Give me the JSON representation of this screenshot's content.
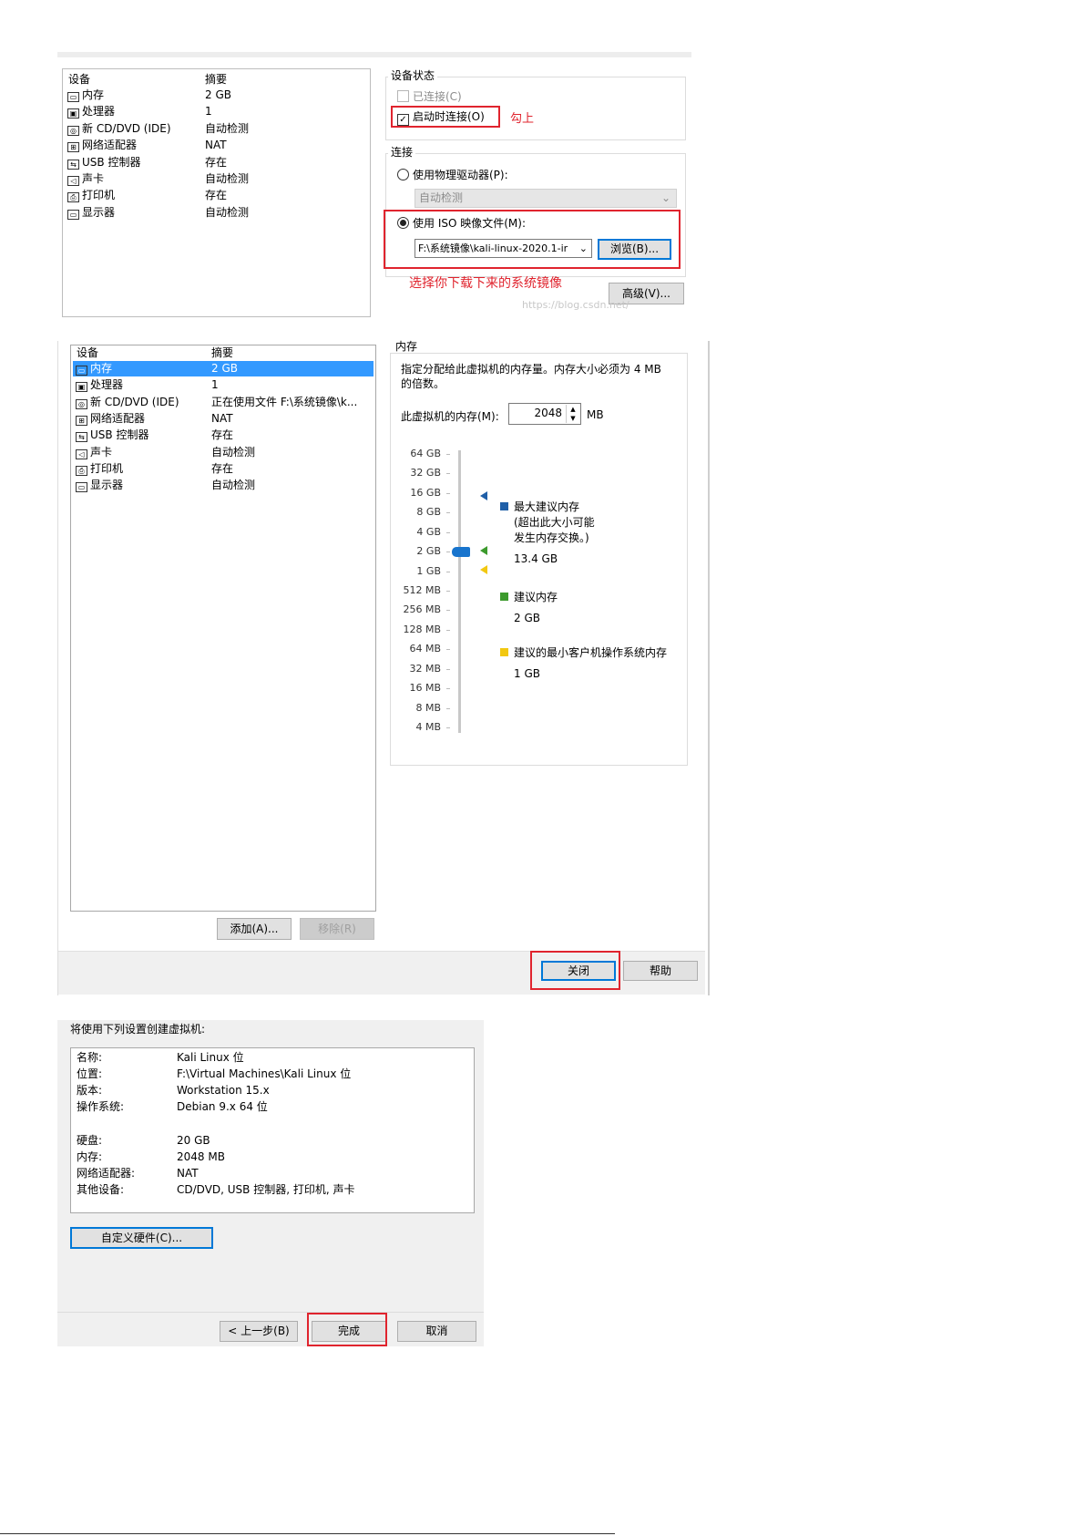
{
  "shot1": {
    "table_header": {
      "device": "设备",
      "summary": "摘要"
    },
    "devices": [
      {
        "icon": "memory-icon",
        "name": "内存",
        "summary": "2 GB"
      },
      {
        "icon": "processor-icon",
        "name": "处理器",
        "summary": "1"
      },
      {
        "icon": "cd-icon",
        "name": "新 CD/DVD (IDE)",
        "summary": "自动检测"
      },
      {
        "icon": "network-icon",
        "name": "网络适配器",
        "summary": "NAT"
      },
      {
        "icon": "usb-icon",
        "name": "USB 控制器",
        "summary": "存在"
      },
      {
        "icon": "sound-icon",
        "name": "声卡",
        "summary": "自动检测"
      },
      {
        "icon": "printer-icon",
        "name": "打印机",
        "summary": "存在"
      },
      {
        "icon": "display-icon",
        "name": "显示器",
        "summary": "自动检测"
      }
    ],
    "device_status": {
      "title": "设备状态",
      "connected": "已连接(C)",
      "connect_on_start": "启动时连接(O)",
      "annotation": "勾上"
    },
    "connection": {
      "title": "连接",
      "physical": "使用物理驱动器(P):",
      "physical_value": "自动检测",
      "iso": "使用 ISO 映像文件(M):",
      "iso_path": "F:\\系统镜像\\kali-linux-2020.1-ir",
      "browse": "浏览(B)...",
      "annotation": "选择你下载下来的系统镜像"
    },
    "advanced": "高级(V)...",
    "watermark": "https://blog.csdn.net/"
  },
  "shot2": {
    "table_header": {
      "device": "设备",
      "summary": "摘要"
    },
    "devices": [
      {
        "icon": "memory-icon",
        "name": "内存",
        "summary": "2 GB",
        "selected": true
      },
      {
        "icon": "processor-icon",
        "name": "处理器",
        "summary": "1"
      },
      {
        "icon": "cd-icon",
        "name": "新 CD/DVD (IDE)",
        "summary": "正在使用文件 F:\\系统镜像\\k..."
      },
      {
        "icon": "network-icon",
        "name": "网络适配器",
        "summary": "NAT"
      },
      {
        "icon": "usb-icon",
        "name": "USB 控制器",
        "summary": "存在"
      },
      {
        "icon": "sound-icon",
        "name": "声卡",
        "summary": "自动检测"
      },
      {
        "icon": "printer-icon",
        "name": "打印机",
        "summary": "存在"
      },
      {
        "icon": "display-icon",
        "name": "显示器",
        "summary": "自动检测"
      }
    ],
    "memory": {
      "title": "内存",
      "desc_line1": "指定分配给此虚拟机的内存量。内存大小必须为 4 MB",
      "desc_line2": "的倍数。",
      "label": "此虚拟机的内存(M):",
      "value": "2048",
      "unit": "MB",
      "scale": [
        "64 GB",
        "32 GB",
        "16 GB",
        "8 GB",
        "4 GB",
        "2 GB",
        "1 GB",
        "512 MB",
        "256 MB",
        "128 MB",
        "64 MB",
        "32 MB",
        "16 MB",
        "8 MB",
        "4 MB"
      ],
      "legend": [
        {
          "color": "#1f5fa8",
          "title": "最大建议内存",
          "note1": "(超出此大小可能",
          "note2": "发生内存交换。)",
          "value": "13.4 GB"
        },
        {
          "color": "#3c9a2d",
          "title": "建议内存",
          "value": "2 GB"
        },
        {
          "color": "#f2c811",
          "title": "建议的最小客户机操作系统内存",
          "value": "1 GB"
        }
      ]
    },
    "add": "添加(A)...",
    "remove": "移除(R)",
    "close": "关闭",
    "help": "帮助"
  },
  "shot3": {
    "heading": "将使用下列设置创建虚拟机:",
    "summary": [
      {
        "k": "名称:",
        "v": "Kali Linux 位"
      },
      {
        "k": "位置:",
        "v": "F:\\Virtual Machines\\Kali Linux 位"
      },
      {
        "k": "版本:",
        "v": "Workstation 15.x"
      },
      {
        "k": "操作系统:",
        "v": "Debian 9.x 64 位"
      },
      {
        "k": "硬盘:",
        "v": "20 GB"
      },
      {
        "k": "内存:",
        "v": "2048 MB"
      },
      {
        "k": "网络适配器:",
        "v": "NAT"
      },
      {
        "k": "其他设备:",
        "v": "CD/DVD, USB 控制器, 打印机, 声卡"
      }
    ],
    "customize": "自定义硬件(C)...",
    "back": "< 上一步(B)",
    "finish": "完成",
    "cancel": "取消"
  }
}
